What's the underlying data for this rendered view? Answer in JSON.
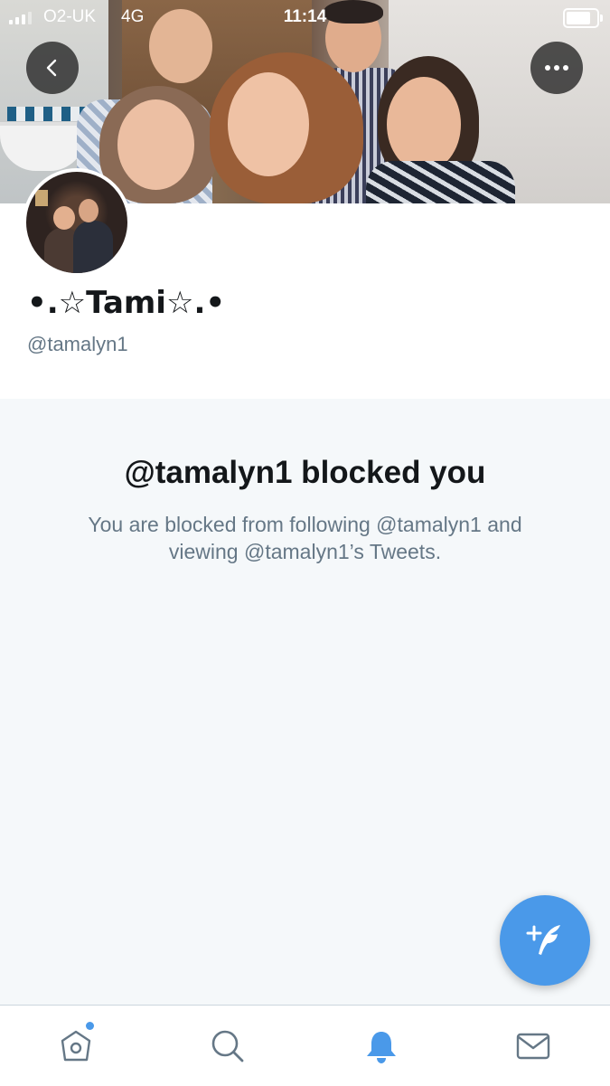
{
  "status_bar": {
    "carrier": "O2-UK",
    "network": "4G",
    "time": "11:14"
  },
  "header": {
    "back_icon": "chevron-left-icon",
    "more_icon": "ellipsis-icon"
  },
  "profile": {
    "display_name": "•.☆Tami☆.•",
    "handle": "@tamalyn1"
  },
  "blocked": {
    "title": "@tamalyn1 blocked you",
    "message": "You are blocked from following @tamalyn1 and viewing @tamalyn1’s Tweets."
  },
  "compose": {
    "icon": "compose-tweet-icon"
  },
  "tab_bar": {
    "items": [
      {
        "name": "home",
        "icon": "home-icon",
        "has_dot": true
      },
      {
        "name": "search",
        "icon": "search-icon"
      },
      {
        "name": "notifications",
        "icon": "bell-icon",
        "active": true
      },
      {
        "name": "messages",
        "icon": "mail-icon"
      }
    ]
  },
  "colors": {
    "accent": "#4a99e9",
    "text_primary": "#14171a",
    "text_secondary": "#657786",
    "panel_bg": "#f5f8fa"
  }
}
